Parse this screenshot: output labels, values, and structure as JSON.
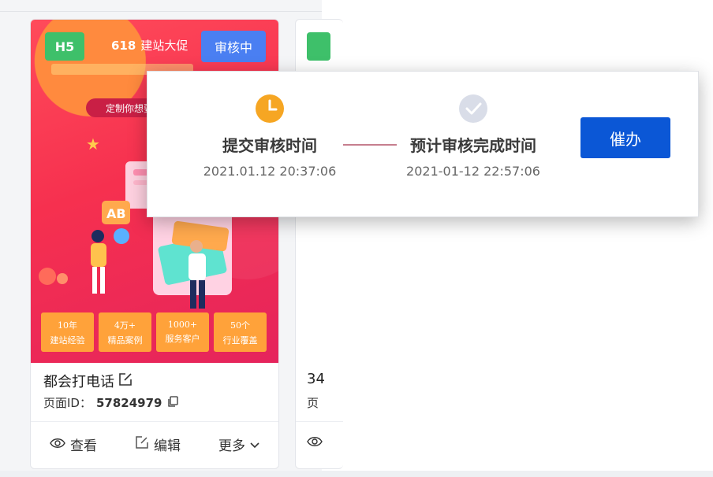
{
  "card_main": {
    "type_tag": "H5",
    "promo_number": "618",
    "promo_text": "建站大促",
    "status_badge": "审核中",
    "subtitle_pill": "定制你想要",
    "stats": [
      {
        "top": "10年",
        "bottom": "建站经验"
      },
      {
        "top": "4万+",
        "bottom": "精品案例"
      },
      {
        "top": "1000+",
        "bottom": "服务客户"
      },
      {
        "top": "50个",
        "bottom": "行业覆盖"
      }
    ],
    "title": "都会打电话",
    "id_label": "页面ID：",
    "id_value": "57824979",
    "actions": {
      "view": "查看",
      "edit": "编辑",
      "more": "更多"
    }
  },
  "card_second": {
    "title_partial": "34",
    "id_partial": "页"
  },
  "popup": {
    "step1_label": "提交审核时间",
    "step1_time": "2021.01.12 20:37:06",
    "step2_label": "预计审核完成时间",
    "step2_time": "2021-01-12 22:57:06",
    "urge_button": "催办"
  },
  "colors": {
    "status_blue": "#4a7ff2",
    "h5_green": "#3ec06a",
    "urge_blue": "#0b57d6",
    "clock_orange": "#f6a623",
    "done_gray": "#d9dde8"
  }
}
